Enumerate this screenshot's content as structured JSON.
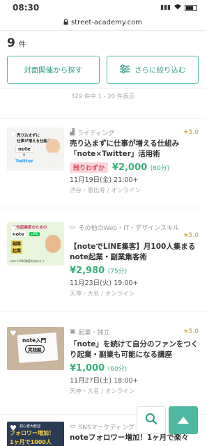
{
  "status_bar": {
    "time": "08:30"
  },
  "url_bar": {
    "url": "street-academy.com"
  },
  "results": {
    "count": "9",
    "unit": "件",
    "info": "329 件中 1 - 20 件表示"
  },
  "buttons": {
    "offline": "対面開催から探す",
    "refine": "さらに絞り込む"
  },
  "cards": [
    {
      "thumb_text": [
        "売り込まずに",
        "仕事が増える仕組み",
        "note",
        "Twitter"
      ],
      "category": "ライティング",
      "rating": "5.0",
      "title": "売り込まずに仕事が増える仕組み「note×Twitter」活用術",
      "badge": "残りわずか",
      "price": "¥2,000",
      "duration": "(60分)",
      "date": "11月19日(金) 21:00+",
      "location": "渋谷・恵比寿 / オンライン"
    },
    {
      "thumb_text": [
        "女性起業家のための",
        "note",
        "LINE",
        "副業",
        "起業",
        "noteでLINE集客を始めよう"
      ],
      "category": "その他のWeb・IT・デザインスキル",
      "rating": "5.0",
      "title": "【noteでLINE集客】月100人集まるnote起業・副業集客術",
      "price": "¥2,980",
      "duration": "(75分)",
      "date": "11月23日(火) 19:00+",
      "location": "天神・大名 / オンライン"
    },
    {
      "thumb_text": [
        "note入門",
        "実践編"
      ],
      "category": "起業・独立",
      "rating": "5.0",
      "title": "「note」を続けて自分のファンをつくり起業・副業も可能になる講座",
      "price": "¥1,000",
      "duration": "(60分)",
      "date": "11月27日(土) 18:00+",
      "location": "天神・大名 / オンライン"
    },
    {
      "thumb_text": [
        "初心者大歓迎",
        "フォロワー増加！",
        "1ヶ月で1000人"
      ],
      "category": "SNSマーケティング",
      "title": "noteフォロワー増加！1ヶ月で楽々"
    }
  ],
  "colors": {
    "accent": "#4fb8a3",
    "price": "#39b27b",
    "badge_bg": "#fbd7dc",
    "star": "#e8b43a"
  }
}
